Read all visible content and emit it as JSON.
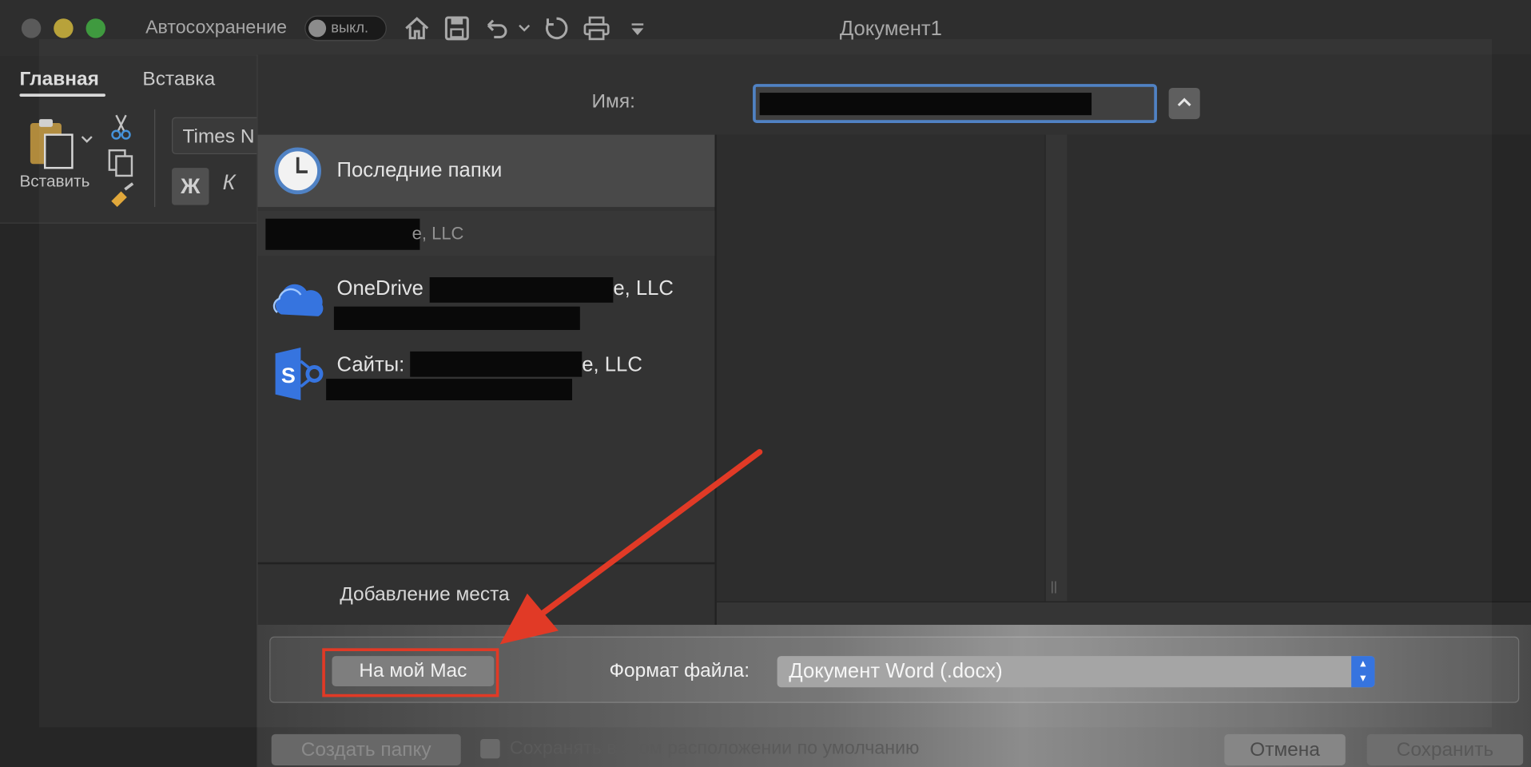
{
  "titlebar": {
    "autosave_label": "Автосохранение",
    "autosave_state": "выкл.",
    "doc_title": "Документ1",
    "icons": [
      "home-icon",
      "save-icon",
      "undo-icon",
      "chevron-down-icon",
      "redo-icon",
      "print-icon",
      "customize-icon"
    ]
  },
  "ribbon": {
    "tabs": [
      "Главная",
      "Вставка"
    ],
    "paste_label": "Вставить",
    "font_name": "Times N",
    "bold_label": "Ж",
    "italic_label": "К"
  },
  "dialog": {
    "name_label": "Имя:",
    "name_value": "",
    "sidebar": {
      "recent_label": "Последние папки",
      "org_header": "e, LLC",
      "locations": [
        {
          "title_prefix": "OneDrive",
          "title_suffix": "e, LLC",
          "icon": "onedrive-cloud-icon"
        },
        {
          "title_prefix": "Сайты:",
          "title_suffix": "e, LLC",
          "icon": "sharepoint-icon"
        }
      ],
      "add_place_label": "Добавление места"
    },
    "on_my_mac_label": "На мой Mac",
    "format_label": "Формат файла:",
    "format_value": "Документ Word (.docx)",
    "create_folder_label": "Создать папку",
    "default_location_label": "Сохранять в этом расположении по умолчанию",
    "cancel_label": "Отмена",
    "save_label": "Сохранить"
  },
  "colors": {
    "highlight": "#e0331f",
    "accent_blue": "#2f6fde",
    "input_focus": "#4a7ec2"
  }
}
